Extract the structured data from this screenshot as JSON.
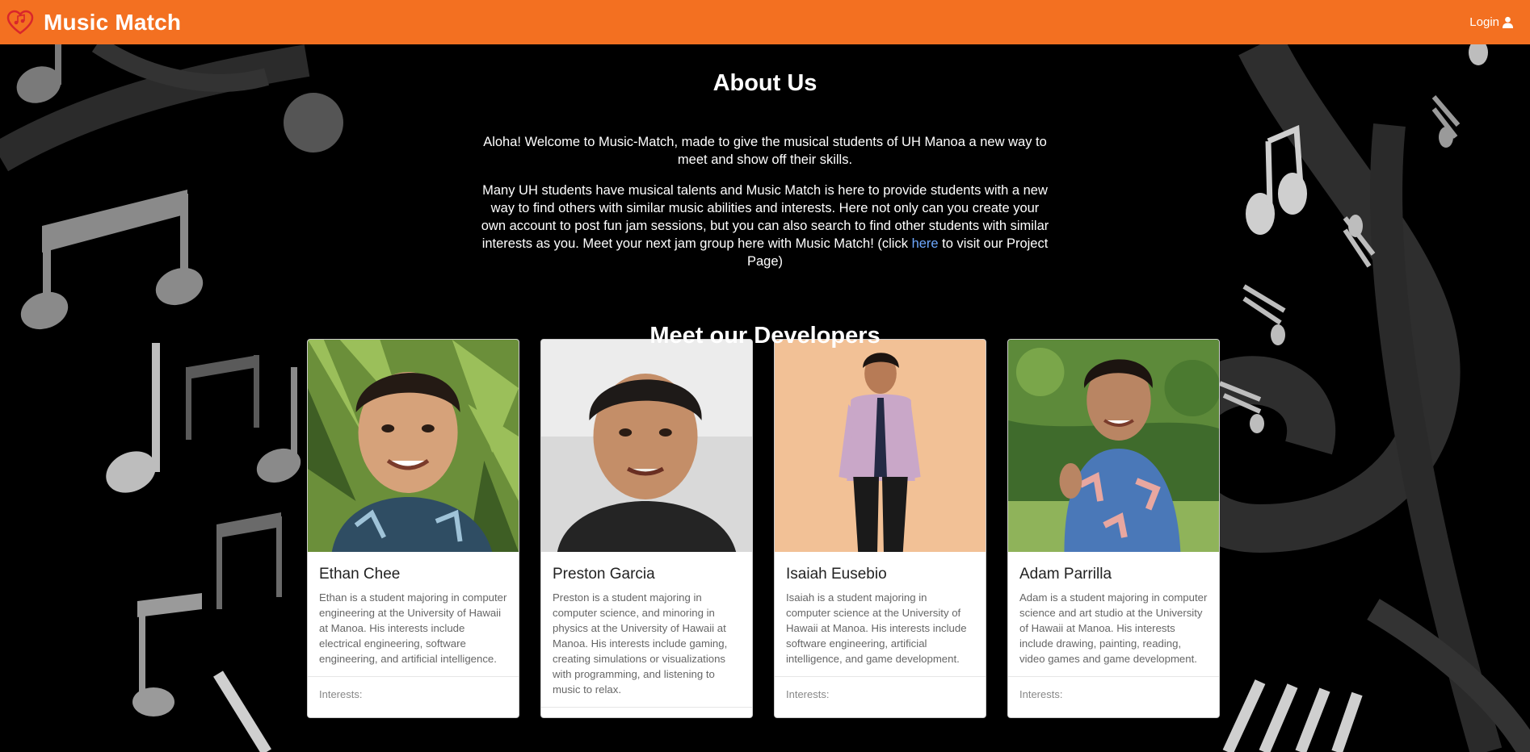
{
  "navbar": {
    "brand_title": "Music Match",
    "login_label": "Login"
  },
  "about": {
    "title": "About Us",
    "paragraph1": "Aloha! Welcome to Music-Match, made to give the musical students of UH Manoa a new way to meet and show off their skills.",
    "paragraph2_before_link": "Many UH students have musical talents and Music Match is here to provide students with a new way to find others with similar music abilities and interests. Here not only can you create your own account to post fun jam sessions, but you can also search to find other students with similar interests as you. Meet your next jam group here with Music Match! (click ",
    "link_text": "here",
    "paragraph2_after_link": " to visit our Project Page)"
  },
  "developers": {
    "title": "Meet our Developers",
    "interests_label": "Interests:",
    "people": [
      {
        "name": "Ethan Chee",
        "description": "Ethan is a student majoring in computer engineering at the University of Hawaii at Manoa. His interests include electrical engineering, software engineering, and artificial intelligence."
      },
      {
        "name": "Preston Garcia",
        "description": "Preston is a student majoring in computer science, and minoring in physics at the University of Hawaii at Manoa. His interests include gaming, creating simulations or visualizations with programming, and listening to music to relax."
      },
      {
        "name": "Isaiah Eusebio",
        "description": "Isaiah is a student majoring in computer science at the University of Hawaii at Manoa. His interests include software engineering, artificial intelligence, and game development."
      },
      {
        "name": "Adam Parrilla",
        "description": "Adam is a student majoring in computer science and art studio at the University of Hawaii at Manoa. His interests include drawing, painting, reading, video games and game development."
      }
    ]
  },
  "colors": {
    "navbar": "#f37021",
    "background": "#000000",
    "link": "#6ea8fe"
  }
}
